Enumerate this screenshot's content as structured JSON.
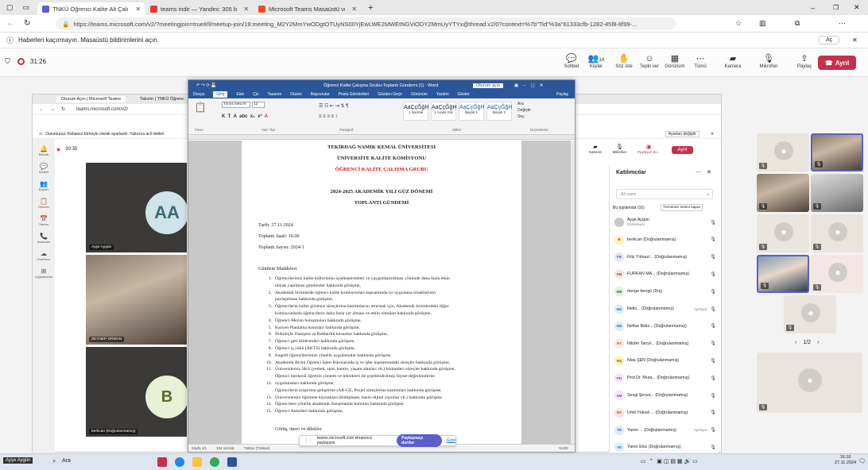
{
  "browser": {
    "tabs": [
      {
        "label": "TNKÜ Öğrenci Kalite Alt Çalı",
        "color": "#5b5fc7",
        "active": true
      },
      {
        "label": "teams indir — Yandex: 305 bin sc",
        "color": "#e53935",
        "active": false
      },
      {
        "label": "Microsoft Teams Masaüstü ve Mo",
        "color": "#f25022",
        "active": false
      }
    ],
    "url": "https://teams.microsoft.com/v2/?meetingjoin=true#/l/meetup-join/19:meeting_M2Y2MmYwODgtOTUyNS00YjEwLWE2MWEtNGViODY2MmUyYTYx@thread.v2/0?context=%7b\"Tid\"%3a\"61333cfb-1282-45f8-8f99-...",
    "notification": "Haberleri kaçırmayın. Masaüstü bildirimlerini açın.",
    "notification_button": "Aç"
  },
  "meeting": {
    "timer": "31:26",
    "buttons": [
      {
        "label": "Sohbet",
        "icon": "chat-icon"
      },
      {
        "label": "Kişiler",
        "icon": "people-icon",
        "badge": "14"
      },
      {
        "label": "Söz iste",
        "icon": "hand-icon"
      },
      {
        "label": "Tepki ver",
        "icon": "smile-icon"
      },
      {
        "label": "Görünüm",
        "icon": "grid-icon"
      },
      {
        "label": "Tümü",
        "icon": "more-icon"
      },
      {
        "label": "Kamera",
        "icon": "camera-off-icon"
      },
      {
        "label": "Mikrofon",
        "icon": "mic-off-icon"
      },
      {
        "label": "Paylaş",
        "icon": "share-icon"
      }
    ],
    "leave_label": "Ayrıl"
  },
  "shared": {
    "inner_tabs": [
      "Oturum Açın | Microsoft Teams",
      "Takvim | TNKÜ Öğrenc"
    ],
    "inner_url": "teams.microsoft.com/v2/",
    "banner": "Durumunuz Rahatsız Etmeyin olarak ayarlandı. Yalnızca acil iletileri",
    "banner_right": "Ayarları değiştir",
    "inner_timer": "30:35",
    "sidebar": [
      "Etkinlik",
      "Sohbet",
      "Ekipler",
      "Ödevler",
      "Takvim",
      "Aramalar",
      "OneDrive",
      "Uygulamalar"
    ],
    "inner_buttons": [
      "Kamera",
      "Mikrofon",
      "Paylaşım du..."
    ],
    "inner_leave": "Ayrıl",
    "tiles": [
      {
        "initials": "AA",
        "name": "Ayşe Aygün"
      },
      {
        "initials": "",
        "name": "ZEYNEP ORMAN"
      },
      {
        "initials": "B",
        "name": "berkcan (Doğrulanmamış)"
      }
    ],
    "sharing_text": "teams.microsoft.com ekranınızı paylaşıyor.",
    "stop_label": "Paylaşmayı durdur",
    "hide_label": "Gizle"
  },
  "word": {
    "title": "Öğrenci Kalite Çalışma Grubu-Toplantı Gündemi (1) - Word",
    "signin": "Oturum açın",
    "menu": [
      "Dosya",
      "Giriş",
      "Ekle",
      "Çiz",
      "Tasarım",
      "Düzen",
      "Başvurular",
      "Posta Gönderileri",
      "Gözden Geçir",
      "Görünüm",
      "Yardım",
      "Göster"
    ],
    "share": "Paylaş",
    "ribbon_groups": [
      "Pano",
      "Yazı Tipi",
      "Paragraf",
      "Stiller",
      "Düzenleme"
    ],
    "font_name": "Times New R",
    "font_size": "12",
    "styles": [
      "1 Normal",
      "1 Aralık Yok",
      "Başlık 1",
      "Başlık 2"
    ],
    "edit_items": [
      "Ara",
      "Değiştir",
      "Seç"
    ],
    "status": [
      "Sayfa 1/1",
      "194 sözcük",
      "Türkçe (Türkiye)"
    ],
    "zoom": "%100",
    "doc": {
      "h1": "TEKİRDAĞ NAMIK KEMAL ÜNİVERSİTESİ",
      "h2": "ÜNİVERSİTE KALİTE KOMİSYONU",
      "h3": "ÖĞRENCİ KALİTE ÇALIŞMA GRUBU",
      "h4": "2024-2025 AKADEMİK YILI GÜZ DÖNEMİ",
      "h5": "TOPLANTI GÜNDEMİ",
      "date": "Tarih: 27.11.2024",
      "time": "Toplantı Saati: 16.00",
      "number": "Toplantı Sayısı: 2024/1",
      "agenda_title": "Gündem Maddeleri",
      "items": [
        "Öğrencilerimiz kalite kültürünün içselleştirmeleri ve yaygınlaştırılması yönünde daha fazla etkin",
        "olarak yapılması gerekenler hakkında görüşme,",
        "Akademik birimlerde öğrenci kalite komisyonları kapsamında iyi uygulama örneklerinin",
        "paylaşılması hakkında görüşme,",
        "Öğrencilerin kalite güvence süreçlerine katılımlarını artırmak için, Akademik birimlerdeki diğer",
        "komisyonlarda öğrencilerin daha fazla yer alması ve etkin olmaları hakkında görüşme,",
        "Öğrenci-Mezun buluşmaları hakkında görüşme,",
        "Kariyer Planlama hususları hakkında görüşme,",
        "Psikolojik Danışma ve Rehberlik hususları hakkında görüşme,",
        "Öğrenci geri bildirimleri hakkında görüşme,",
        "Öğrenci iş yükü (AKTS) hakkında görüşme,",
        "Engelli öğrencilerimize yönelik uygulamalar hakkında görüşme,",
        "Akademik Birim Öğrenci İşleri Bürolarında iş ve işler kapsamındaki süreçler hakkında görüşme,",
        "Üniversitemiz SKS (yemek, spor, kantin, yaşam alanları vb.) hizmetleri süreçler hakkında görüşme,",
        "Öğrenci merkezli öğretim yöntem ve teknikleri ile çeşitlendirilmiş ölçme-değerlendirme",
        "uygulamaları hakkında görüşme,",
        "Öğrencilerin araştırma-geliştirme (AR-GE, Proje) süreçlerine katılımları hakkında görüşme,",
        "Üniversitemiz öğrenme kaynakları (kütüphane, basılı-dijital yayınlar vb.) hakkında görüşme",
        "Öğrencilere yönelik akademik danışmanlık konuları hakkında görüşme",
        "Öğrenci Anketleri hakkında görüşme,"
      ],
      "numbers": [
        "1.",
        "",
        "2.",
        "",
        "3.",
        "",
        "4.",
        "5.",
        "6.",
        "7.",
        "8.",
        "9.",
        "10.",
        "11.",
        "",
        "12.",
        "",
        "13.",
        "14.",
        "15.",
        "16."
      ],
      "closing": "Görüş, öneri ve dilekler"
    }
  },
  "participants": {
    "title": "Katılımcılar",
    "search_placeholder": "Ad yazın",
    "section": "Bu toplantıda (16)",
    "mute_all": "Tümünün sesini kapat",
    "list": [
      {
        "initials": "",
        "name": "Ayşe Aygün",
        "sub": "Düzenleyici",
        "bg": "#c7c7c7",
        "fg": "#fff"
      },
      {
        "initials": "B",
        "name": "berkcan (Doğrulanmamış)",
        "bg": "#fff2b3",
        "fg": "#7a6100"
      },
      {
        "initials": "FB",
        "name": "Filiz Yılmaz/... (Doğrulanmamış)",
        "bg": "#e8e4f6",
        "fg": "#5b5fc7"
      },
      {
        "initials": "FM",
        "name": "FURKAN MA... (Doğrulanmamış)",
        "bg": "#fde2e2",
        "fg": "#c4314b"
      },
      {
        "initials": "MB",
        "name": "merge bengü (Dış)",
        "bg": "#e2f0e3",
        "fg": "#237b4b"
      },
      {
        "initials": "NG",
        "name": "Nefis... (Doğrulanmamış)",
        "bg": "#deecf9",
        "fg": "#0f6cbd",
        "extra": "Ayrılıyor"
      },
      {
        "initials": "NG",
        "name": "Nefise Beliz... (Doğrulanmamış)",
        "bg": "#deecf9",
        "fg": "#0f6cbd"
      },
      {
        "initials": "NT",
        "name": "Nilüfer Tanyıl... (Doğrulanmamış)",
        "bg": "#fde7e0",
        "fg": "#c25a2e"
      },
      {
        "initials": "NŞ",
        "name": "Nisa ŞEN (Doğrulanmamış)",
        "bg": "#fff2b3",
        "fg": "#7a6100"
      },
      {
        "initials": "PD",
        "name": "Prof.Dr. Mura... (Doğrulanmamış)",
        "bg": "#f4e6f9",
        "fg": "#8b3fa1"
      },
      {
        "initials": "SM",
        "name": "Sevgi Şevva... (Doğrulanmamış)",
        "bg": "#f4e6f9",
        "fg": "#8b3fa1"
      },
      {
        "initials": "ÜY",
        "name": "Ümit Yüksel ... (Doğrulanmamış)",
        "bg": "#fde2e2",
        "fg": "#c4314b"
      },
      {
        "initials": "YE",
        "name": "Yaren ... (Doğrulanmamış)",
        "bg": "#deecf9",
        "fg": "#0f6cbd",
        "extra": "Ayrılıyor"
      },
      {
        "initials": "YE",
        "name": "Yaren Ekiz (Doğrulanmamış)",
        "bg": "#deecf9",
        "fg": "#0f6cbd"
      }
    ]
  },
  "gallery": {
    "page": "1/2"
  },
  "taskbar": {
    "user": "Ayşe Aygün",
    "search": "Ara",
    "time": "16:10",
    "date": "27.11.2024"
  }
}
